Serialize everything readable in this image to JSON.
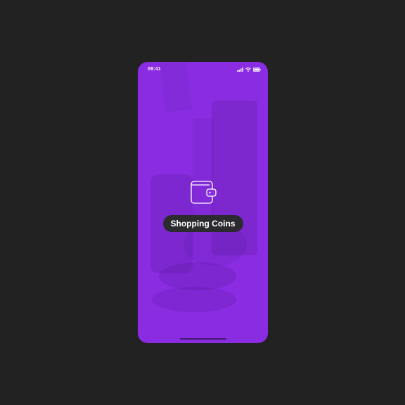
{
  "status_bar": {
    "time": "09:41",
    "icons": [
      "signal-icon",
      "wifi-icon",
      "battery-icon"
    ]
  },
  "splash": {
    "icon": "wallet-icon",
    "app_name": "Shopping Coins"
  },
  "colors": {
    "page_background": "#222222",
    "brand_purple": "#8a2ce2",
    "pill_background": "#2b2b2f",
    "text": "#ffffff"
  }
}
